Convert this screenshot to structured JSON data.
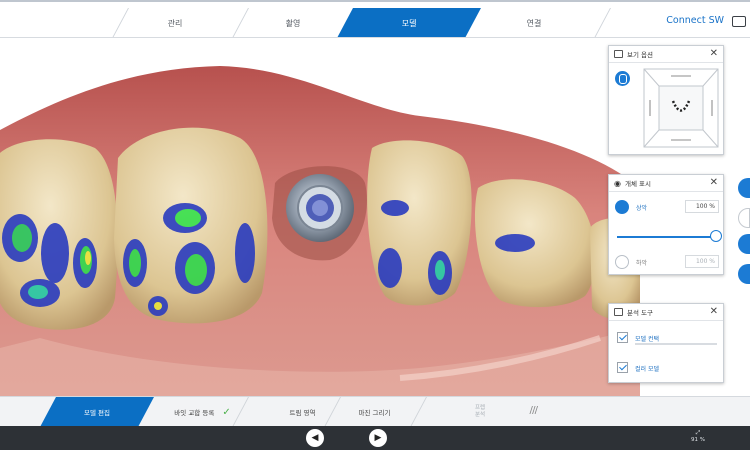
{
  "nav": {
    "tabs": [
      {
        "label": "관리"
      },
      {
        "label": "촬영"
      },
      {
        "label": "모델"
      },
      {
        "label": "연결"
      }
    ],
    "active_tab": "모델",
    "connect_label": "Connect SW"
  },
  "view_panel": {
    "title": "보기 옵션"
  },
  "object_panel": {
    "title": "개체 표시",
    "upper": {
      "label": "상악",
      "value": "100 %"
    },
    "lower": {
      "label": "하악",
      "value": "100 %"
    },
    "upper_opacity": 1.0
  },
  "analysis_panel": {
    "title": "분석 도구",
    "items": [
      {
        "label": "모델 컨택",
        "checked": true
      },
      {
        "label": "컬러 모델",
        "checked": true
      }
    ]
  },
  "workflow": {
    "steps": [
      {
        "label": "모델 편집"
      },
      {
        "label": "바잇 교합 등록"
      },
      {
        "label": "트림 영역"
      },
      {
        "label": "마진 그리기"
      }
    ],
    "disabled_step": {
      "line1": "프렙",
      "line2": "분석"
    }
  },
  "bottom": {
    "zoom": "91 %"
  },
  "colors": {
    "accent": "#0b6fc4",
    "link": "#1a73c8",
    "dark_bar": "#2d3136"
  }
}
